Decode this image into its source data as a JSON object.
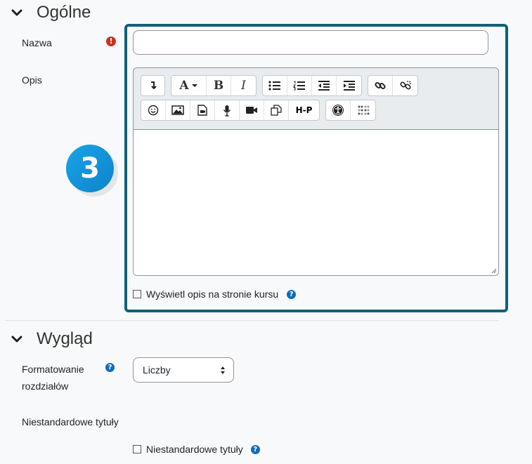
{
  "sections": {
    "general": {
      "title": "Ogólne"
    },
    "appearance": {
      "title": "Wygląd"
    }
  },
  "fields": {
    "name": {
      "label": "Nazwa",
      "value": "",
      "required_icon": "exclamation-icon"
    },
    "description": {
      "label": "Opis"
    },
    "show_description": {
      "label": "Wyświetl opis na stronie kursu",
      "checked": false
    },
    "section_format": {
      "label_line1": "Formatowanie",
      "label_line2": "rozdziałów",
      "selected": "Liczby"
    },
    "custom_titles": {
      "heading": "Niestandardowe tytuły",
      "checkbox_label": "Niestandardowe tytuły",
      "checked": false
    }
  },
  "toolbar": {
    "row1": [
      [
        "collapse-icon"
      ],
      [
        "font-style-icon",
        "bold-icon",
        "italic-icon"
      ],
      [
        "unordered-list-icon",
        "ordered-list-icon",
        "outdent-icon",
        "indent-icon"
      ],
      [
        "link-icon",
        "unlink-icon"
      ]
    ],
    "row2": [
      [
        "emoji-icon",
        "image-icon",
        "media-icon",
        "record-audio-icon",
        "record-video-icon",
        "manage-files-icon",
        "h5p-icon"
      ],
      [
        "accessibility-checker-icon",
        "screenreader-helper-icon"
      ]
    ],
    "glyphs": {
      "font": "A",
      "bold": "B",
      "italic": "I",
      "h5p": "H-P"
    }
  },
  "badge": {
    "number": "3"
  },
  "colors": {
    "highlight_border": "#0f6177",
    "badge": "#1aa3e6",
    "help": "#0f6cbf",
    "required": "#ca3120"
  }
}
